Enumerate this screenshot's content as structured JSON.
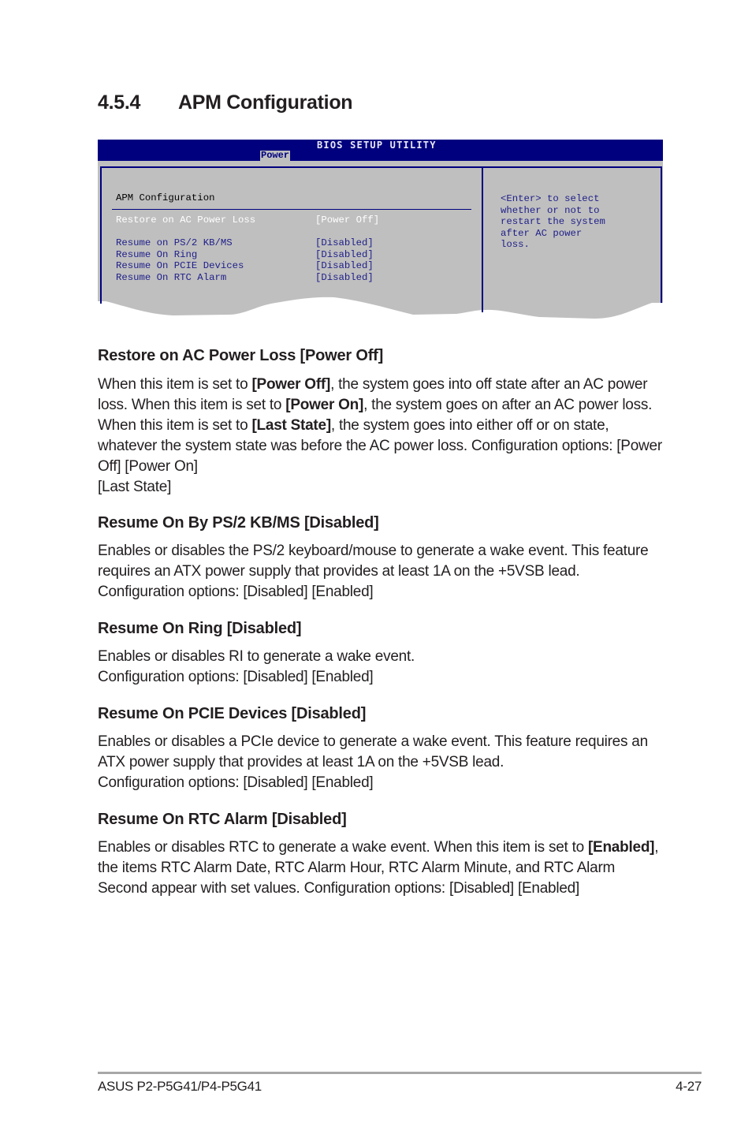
{
  "section": {
    "number": "4.5.4",
    "title": "APM Configuration"
  },
  "bios": {
    "utility_title": "BIOS SETUP UTILITY",
    "active_tab": "Power",
    "panel_title": "APM Configuration",
    "colors": {
      "titlebar": "#00007f",
      "panel": "#bfbfbf",
      "text": "#1e1e8a",
      "selected_text": "#ffffff"
    },
    "items": [
      {
        "label": "Restore on AC Power Loss",
        "value": "[Power Off]",
        "selected": true
      },
      {
        "label": "Resume on PS/2 KB/MS",
        "value": "[Disabled]",
        "selected": false
      },
      {
        "label": "Resume On Ring",
        "value": "[Disabled]",
        "selected": false
      },
      {
        "label": "Resume On PCIE Devices",
        "value": "[Disabled]",
        "selected": false
      },
      {
        "label": "Resume On RTC Alarm",
        "value": "[Disabled]",
        "selected": false
      }
    ],
    "help_lines": [
      "<Enter> to select",
      "whether or not to",
      "restart the system",
      "after AC power",
      "loss."
    ]
  },
  "items": [
    {
      "heading": "Restore on AC Power Loss [Power Off]",
      "paragraph": [
        {
          "t": "When this item is set to "
        },
        {
          "t": "[Power Off]",
          "b": true
        },
        {
          "t": ", the system goes into off state after an AC power loss. When this item is set to "
        },
        {
          "t": "[Power On]",
          "b": true
        },
        {
          "t": ", the system goes on after an AC power loss. When this item is set to "
        },
        {
          "t": "[Last State]",
          "b": true
        },
        {
          "t": ", the system goes into either off or on state, whatever the system state was before the AC power loss. Configuration options: [Power Off] [Power On]"
        },
        {
          "br": true
        },
        {
          "t": "[Last State]"
        }
      ]
    },
    {
      "heading": "Resume On By PS/2 KB/MS [Disabled]",
      "paragraph": [
        {
          "t": "Enables or disables the PS/2 keyboard/mouse to generate a wake event. This feature requires an ATX power supply that provides at least 1A on the +5VSB lead."
        },
        {
          "br": true
        },
        {
          "t": "Configuration options: [Disabled] [Enabled]"
        }
      ]
    },
    {
      "heading": "Resume On Ring [Disabled]",
      "paragraph": [
        {
          "t": "Enables or disables RI to generate a wake event."
        },
        {
          "br": true
        },
        {
          "t": "Configuration options: [Disabled] [Enabled]"
        }
      ]
    },
    {
      "heading": "Resume On PCIE Devices [Disabled]",
      "paragraph": [
        {
          "t": "Enables or disables a PCIe device to generate a wake event. This feature requires an ATX power supply that provides at least 1A on the +5VSB lead."
        },
        {
          "br": true
        },
        {
          "t": "Configuration options: [Disabled] [Enabled]"
        }
      ]
    },
    {
      "heading": "Resume On RTC Alarm [Disabled]",
      "paragraph": [
        {
          "t": "Enables or disables RTC to generate a wake event. When this item is set to "
        },
        {
          "t": "[Enabled]",
          "b": true
        },
        {
          "t": ", the items RTC Alarm Date, RTC Alarm Hour, RTC Alarm Minute, and RTC Alarm Second appear with set values. Configuration options: [Disabled] [Enabled]"
        }
      ]
    }
  ],
  "footer": {
    "product": "ASUS P2-P5G41/P4-P5G41",
    "page_number": "4-27"
  }
}
